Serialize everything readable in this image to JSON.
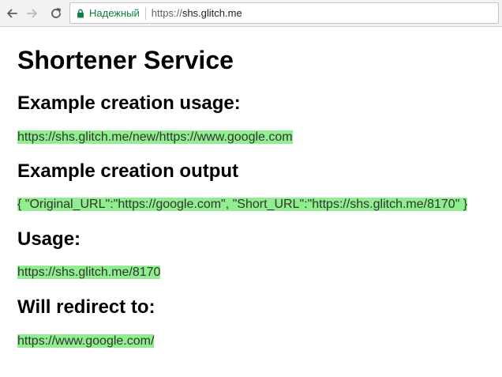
{
  "browser": {
    "security_label": "Надежный",
    "url_scheme": "https://",
    "url_host": "shs.glitch.me",
    "secure_color": "#0b8043"
  },
  "page": {
    "title": "Shortener Service",
    "sections": [
      {
        "heading": "Example creation usage:",
        "example": "https://shs.glitch.me/new/https://www.google.com"
      },
      {
        "heading": "Example creation output",
        "example": "{ \"Original_URL\":\"https://google.com\", \"Short_URL\":\"https://shs.glitch.me/8170\" }"
      },
      {
        "heading": "Usage:",
        "example": "https://shs.glitch.me/8170"
      },
      {
        "heading": "Will redirect to:",
        "example": "https://www.google.com/"
      }
    ],
    "highlight_color": "#90ee90"
  },
  "icons": {
    "back": "arrow-left-icon",
    "forward": "arrow-right-icon",
    "reload": "reload-icon",
    "lock": "lock-icon"
  }
}
